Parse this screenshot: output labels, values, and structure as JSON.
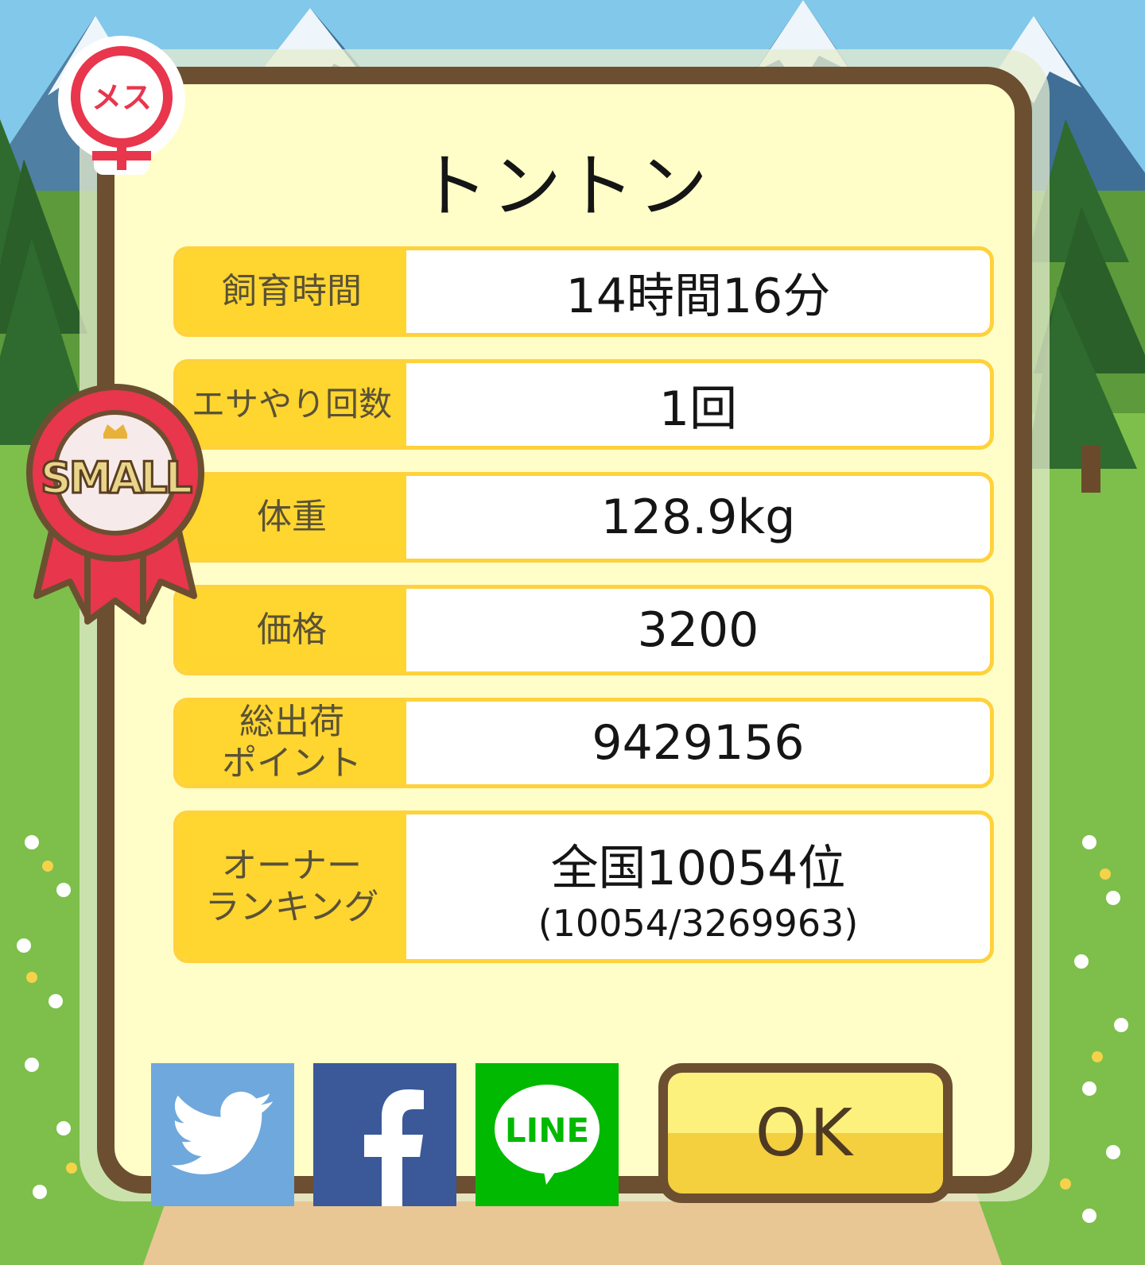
{
  "pig": {
    "name": "トントン",
    "gender_badge": "メス",
    "size_badge": "SMALL"
  },
  "stats": [
    {
      "label": "飼育時間",
      "value": "14時間16分"
    },
    {
      "label": "エサやり回数",
      "value": "1回"
    },
    {
      "label": "体重",
      "value": "128.9kg"
    },
    {
      "label": "価格",
      "value": "3200"
    },
    {
      "label": "総出荷\nポイント",
      "value": "9429156"
    },
    {
      "label": "オーナー\nランキング",
      "value": "全国10054位",
      "sub": "(10054/3269963)"
    }
  ],
  "share": {
    "twitter": "twitter-icon",
    "facebook": "facebook-icon",
    "line": "LINE"
  },
  "ok_label": "OK",
  "colors": {
    "frame": "#6c4f31",
    "card": "#fffec8",
    "label_bg": "#ffd52f",
    "twitter": "#6fa8dc",
    "facebook": "#3b5998",
    "line": "#00b900",
    "badge_red": "#e8364d"
  }
}
